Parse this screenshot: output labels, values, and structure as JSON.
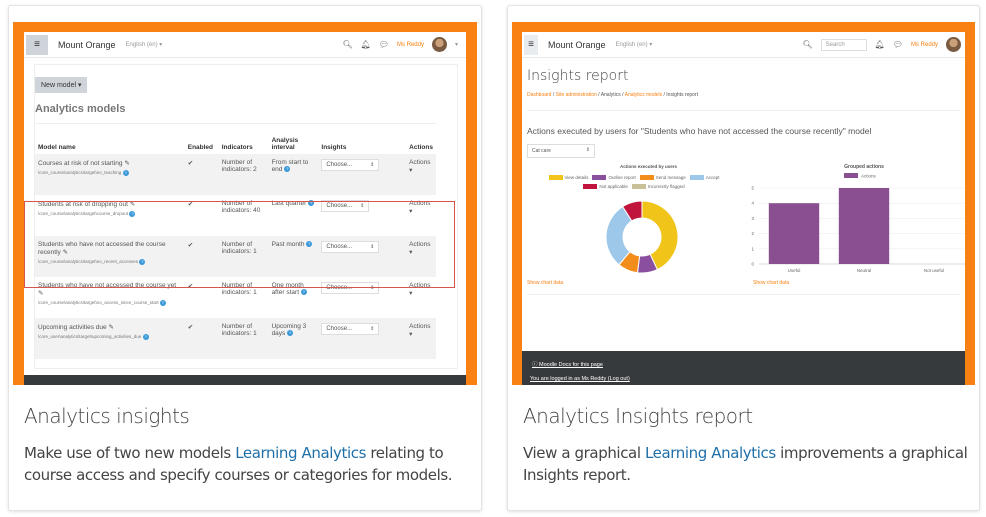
{
  "cards": [
    {
      "title": "Analytics insights",
      "description_parts": [
        "Make use of two new models ",
        "Learning Analytics",
        " relating to course access and specify courses or categories for models."
      ],
      "screen": {
        "navbar": {
          "brand": "Mount Orange",
          "language": "English (en)",
          "user": "Ms Reddy"
        },
        "new_model_button": "New model ▾",
        "heading": "Analytics models",
        "table": {
          "headers": [
            "Model name",
            "Enabled",
            "Indicators",
            "Analysis interval",
            "Insights",
            "Actions"
          ],
          "rows": [
            {
              "name": "Courses at risk of not starting",
              "target": "\\core_course\\analytics\\target\\no_teaching",
              "enabled": "✔",
              "indicators": "Number of indicators: 2",
              "interval": "From start to end",
              "insights": "Choose...",
              "actions": "Actions ▾"
            },
            {
              "name": "Students at risk of dropping out",
              "target": "\\core_course\\analytics\\target\\course_dropout",
              "enabled": "✔",
              "indicators": "Number of indicators: 40",
              "interval": "Last quarter",
              "insights": "Choose...",
              "actions": "Actions ▾"
            },
            {
              "name": "Students who have not accessed the course recently",
              "target": "\\core_course\\analytics\\target\\no_recent_accesses",
              "enabled": "✔",
              "indicators": "Number of indicators: 1",
              "interval": "Past month",
              "insights": "Choose...",
              "actions": "Actions ▾"
            },
            {
              "name": "Students who have not accessed the course yet",
              "target": "\\core_course\\analytics\\target\\no_access_since_course_start",
              "enabled": "✔",
              "indicators": "Number of indicators: 1",
              "interval": "One month after start",
              "insights": "Choose...",
              "actions": "Actions ▾"
            },
            {
              "name": "Upcoming activities due",
              "target": "\\core_user\\analytics\\target\\upcoming_activities_due",
              "enabled": "✔",
              "indicators": "Number of indicators: 1",
              "interval": "Upcoming 3 days",
              "insights": "Choose...",
              "actions": "Actions ▾"
            }
          ]
        }
      }
    },
    {
      "title": "Analytics Insights report",
      "description_parts": [
        "View a graphical ",
        "Learning Analytics",
        " improvements a graphical Insights report."
      ],
      "screen": {
        "navbar": {
          "brand": "Mount Orange",
          "language": "English (en)",
          "search_placeholder": "Search",
          "user": "Ms Reddy"
        },
        "page_title": "Insights report",
        "breadcrumb": [
          "Dashboard",
          "Site administration",
          "Analytics",
          "Analytics models",
          "Insights report"
        ],
        "chart_heading": "Actions executed by users for \"Students who have not accessed the course recently\" model",
        "category_select": "Cat care",
        "show_chart_data": "Show chart data",
        "footer": {
          "docs_link": "Moodle Docs for this page",
          "logged_in": "You are logged in as Ms Reddy (Log out)"
        }
      }
    }
  ],
  "colors": {
    "accent": "#f98012",
    "link": "#1f6fa8",
    "highlight": "#d9534f",
    "help": "#3a9ad9"
  },
  "chart_data": [
    {
      "type": "pie",
      "title": "Actions executed by users",
      "legend_position": "top",
      "categories": [
        "View details",
        "Outline report",
        "Send message",
        "Accept",
        "Not applicable",
        "Incorrectly flagged"
      ],
      "values": [
        43,
        9,
        9,
        30,
        9,
        0
      ],
      "colors": [
        "#f0c419",
        "#8a4f9e",
        "#f28c1a",
        "#9dc8ea",
        "#c0143c",
        "#c9c09a"
      ]
    },
    {
      "type": "bar",
      "title": "Grouped actions",
      "legend_position": "top",
      "categories": [
        "Useful",
        "Neutral",
        "Not useful"
      ],
      "series": [
        {
          "name": "Actions",
          "values": [
            4,
            5,
            0
          ],
          "color": "#894f90"
        }
      ],
      "ylim": [
        0,
        5
      ],
      "yticks": [
        0,
        1,
        2,
        3,
        4,
        5
      ],
      "grid": true
    }
  ]
}
